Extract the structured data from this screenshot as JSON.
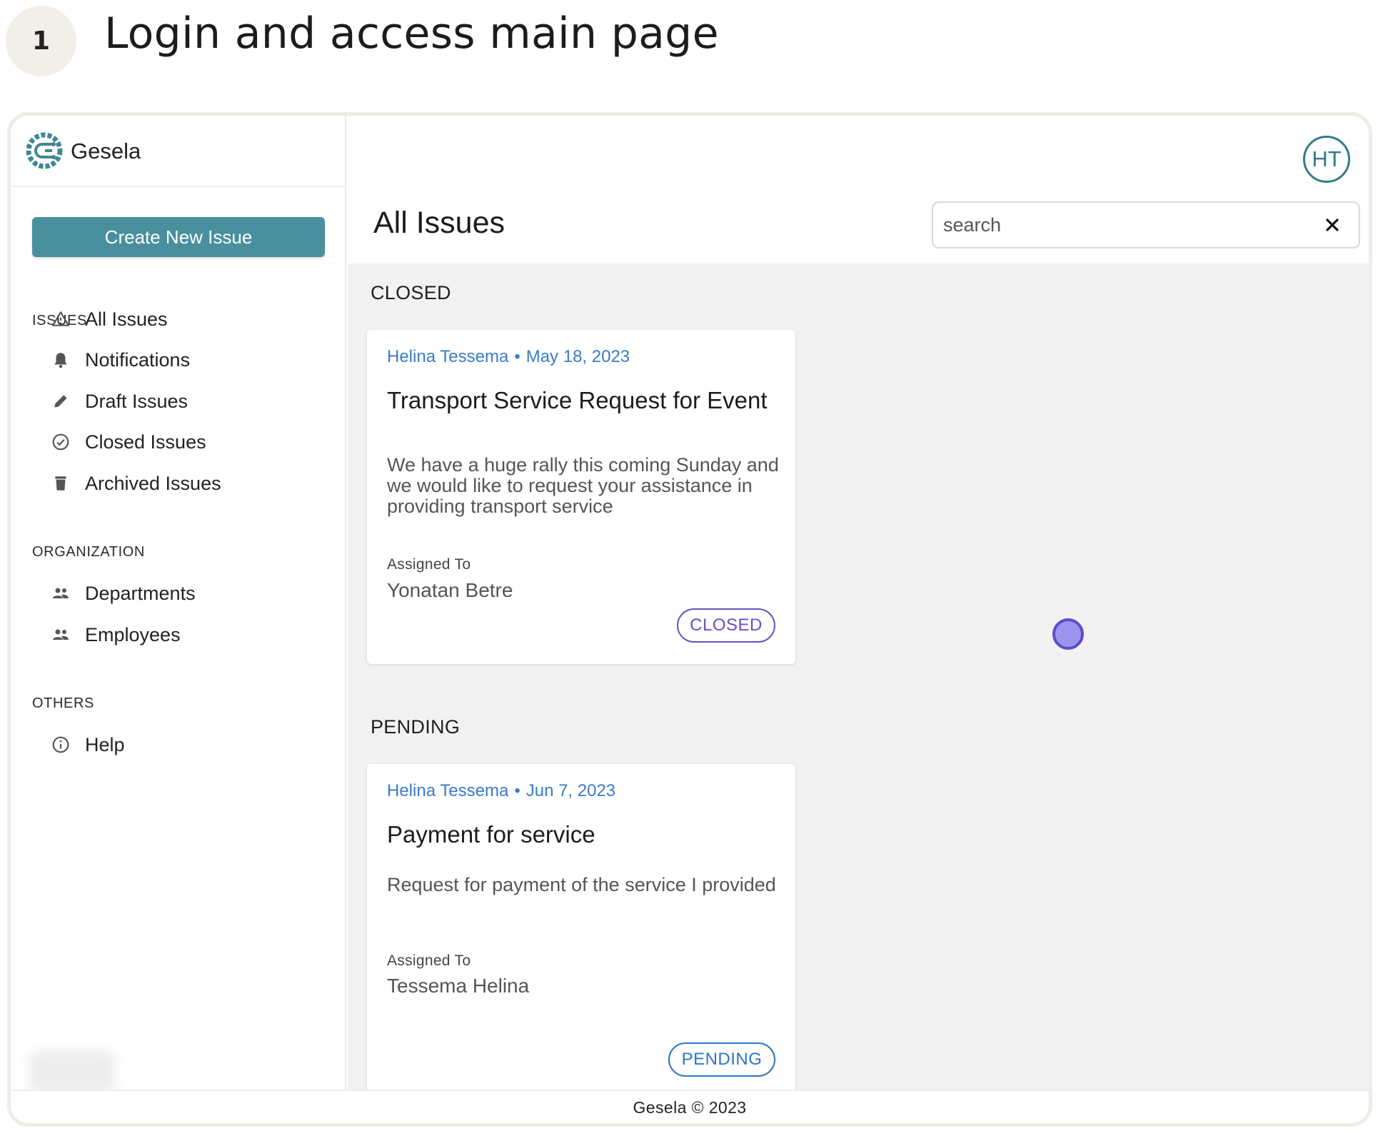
{
  "step": {
    "number": "1",
    "title": "Login and access main page"
  },
  "brand": {
    "name": "Gesela"
  },
  "sidebar": {
    "create_button": "Create New Issue",
    "sections": {
      "issues": {
        "label": "ISSUES",
        "items": [
          {
            "label": "All Issues",
            "icon": "warning-triangle-icon"
          },
          {
            "label": "Notifications",
            "icon": "bell-icon"
          },
          {
            "label": "Draft Issues",
            "icon": "pencil-icon"
          },
          {
            "label": "Closed Issues",
            "icon": "check-circle-icon"
          },
          {
            "label": "Archived Issues",
            "icon": "trash-icon"
          }
        ]
      },
      "organization": {
        "label": "ORGANIZATION",
        "items": [
          {
            "label": "Departments",
            "icon": "people-icon"
          },
          {
            "label": "Employees",
            "icon": "people-icon"
          }
        ]
      },
      "others": {
        "label": "OTHERS",
        "items": [
          {
            "label": "Help",
            "icon": "info-circle-icon"
          }
        ]
      }
    }
  },
  "header": {
    "avatar_initials": "HT",
    "page_title": "All Issues",
    "search": {
      "placeholder": "search",
      "value": ""
    }
  },
  "groups": [
    {
      "title": "CLOSED",
      "cards": [
        {
          "author": "Helina Tessema",
          "separator": "•",
          "date": "May 18, 2023",
          "title": "Transport Service Request for Event",
          "description": "We have a huge rally this coming Sunday and we would like to request your assistance in providing transport service",
          "assigned_label": "Assigned To",
          "assignee": "Yonatan Betre",
          "status": "CLOSED"
        }
      ]
    },
    {
      "title": "PENDING",
      "cards": [
        {
          "author": "Helina Tessema",
          "separator": "•",
          "date": "Jun 7, 2023",
          "title": "Payment for service",
          "description": "Request for payment of the service I provided",
          "assigned_label": "Assigned To",
          "assignee": "Tessema Helina",
          "status": "PENDING"
        }
      ]
    }
  ],
  "footer": {
    "text": "Gesela © 2023"
  },
  "colors": {
    "brand_teal": "#4a8f9d",
    "link_blue": "#3a7bc8",
    "closed_purple": "#6a4fc4",
    "pending_blue": "#2f74c8",
    "content_bg": "#f2f2f2"
  }
}
